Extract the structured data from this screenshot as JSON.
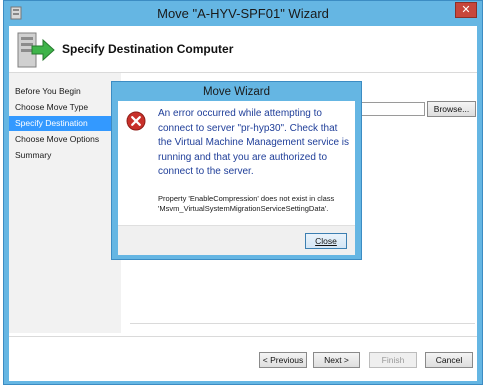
{
  "window": {
    "title": "Move \"A-HYV-SPF01\" Wizard",
    "close_glyph": "✕"
  },
  "header": {
    "title": "Specify Destination Computer",
    "icon": "server-move-icon"
  },
  "nav": {
    "items": [
      {
        "label": "Before You Begin",
        "selected": false
      },
      {
        "label": "Choose Move Type",
        "selected": false
      },
      {
        "label": "Specify Destination",
        "selected": true
      },
      {
        "label": "Choose Move Options",
        "selected": false
      },
      {
        "label": "Summary",
        "selected": false
      }
    ]
  },
  "destination": {
    "computer_value": "",
    "browse_label": "Browse..."
  },
  "buttons": {
    "previous": "< Previous",
    "next": "Next >",
    "finish": "Finish",
    "cancel": "Cancel"
  },
  "dialog": {
    "title": "Move Wizard",
    "icon": "error-icon",
    "message": "An error occurred while attempting to connect to server \"pr-hyp30\". Check that the Virtual Machine Management service is running and that you are authorized to connect to the server.",
    "detail": "Property 'EnableCompression' does not exist in class 'Msvm_VirtualSystemMigrationServiceSettingData'.",
    "close_label": "Close"
  },
  "colors": {
    "window_frame": "#65b6e3",
    "selection": "#3399ff",
    "error_text": "#1f3e99",
    "error_icon": "#c8302a",
    "close_button": "#c7463b"
  }
}
